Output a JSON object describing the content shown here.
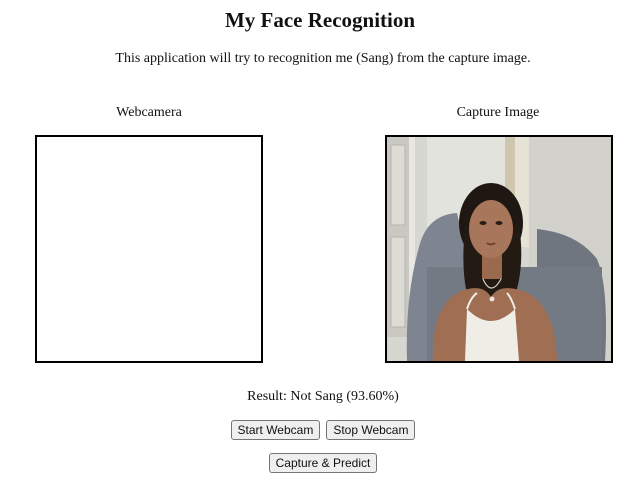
{
  "header": {
    "title": "My Face Recognition",
    "description": "This application will try to recognition me (Sang) from the capture image."
  },
  "panels": {
    "webcam_label": "Webcamera",
    "capture_label": "Capture Image"
  },
  "result": {
    "text": "Result: Not Sang (93.60%)"
  },
  "buttons": {
    "start_webcam": "Start Webcam",
    "stop_webcam": "Stop Webcam",
    "capture_predict": "Capture & Predict"
  }
}
